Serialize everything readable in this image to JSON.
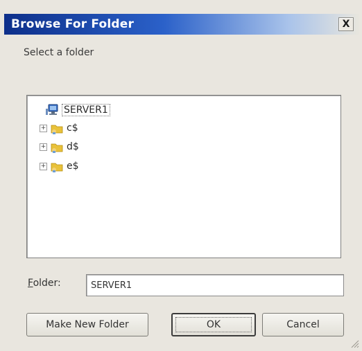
{
  "window": {
    "title": "Browse For Folder",
    "close_label": "X"
  },
  "instruction": "Select a folder",
  "tree": {
    "root": {
      "label": "SERVER1",
      "icon": "network-computer-icon"
    },
    "items": [
      {
        "label": "c$",
        "icon": "shared-folder-icon",
        "expander": "+"
      },
      {
        "label": "d$",
        "icon": "shared-folder-icon",
        "expander": "+"
      },
      {
        "label": "e$",
        "icon": "shared-folder-icon",
        "expander": "+"
      }
    ]
  },
  "folder_field": {
    "label_accel": "F",
    "label_rest": "older:",
    "value": "SERVER1"
  },
  "buttons": {
    "make_new_folder": "Make New Folder",
    "ok": "OK",
    "cancel": "Cancel"
  },
  "colors": {
    "title_bar_start": "#0d2f8a",
    "title_bar_end": "#a9c3ea",
    "dialog_bg": "#e9e6df",
    "folder_yellow": "#e9c23a"
  }
}
